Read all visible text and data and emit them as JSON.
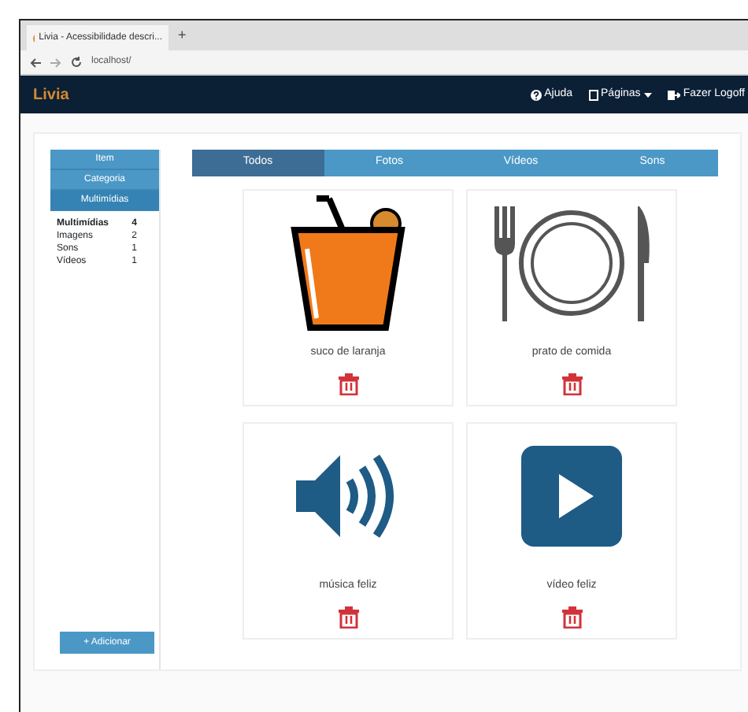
{
  "browser": {
    "tab_title": "Livia - Acessibilidade descri...",
    "new_tab": "+",
    "url": "localhost/"
  },
  "navbar": {
    "brand": "Livia",
    "links": [
      {
        "label": "Ajuda",
        "kind": "help"
      },
      {
        "label": "Páginas",
        "kind": "pages"
      },
      {
        "label": "Fazer Logoff",
        "kind": "logoff"
      }
    ]
  },
  "sidebar": {
    "menu": [
      {
        "label": "Item",
        "selected": false
      },
      {
        "label": "Categoria",
        "selected": false
      },
      {
        "label": "Multimídias",
        "selected": true
      }
    ],
    "counts": [
      {
        "label": "Multimídias",
        "count": "4",
        "bold": true
      },
      {
        "label": "Imagens",
        "count": "2",
        "bold": false
      },
      {
        "label": "Sons",
        "count": "1",
        "bold": false
      },
      {
        "label": "Vídeos",
        "count": "1",
        "bold": false
      }
    ],
    "add_button": "+ Adicionar"
  },
  "tabs": [
    {
      "label": "Todos",
      "selected": true
    },
    {
      "label": "Fotos",
      "selected": false
    },
    {
      "label": "Vídeos",
      "selected": false
    },
    {
      "label": "Sons",
      "selected": false
    }
  ],
  "items": [
    {
      "caption": "suco de laranja",
      "kind": "juice"
    },
    {
      "caption": "prato de comida",
      "kind": "plate"
    },
    {
      "caption": "música feliz",
      "kind": "sound"
    },
    {
      "caption": "vídeo feliz",
      "kind": "video"
    }
  ]
}
